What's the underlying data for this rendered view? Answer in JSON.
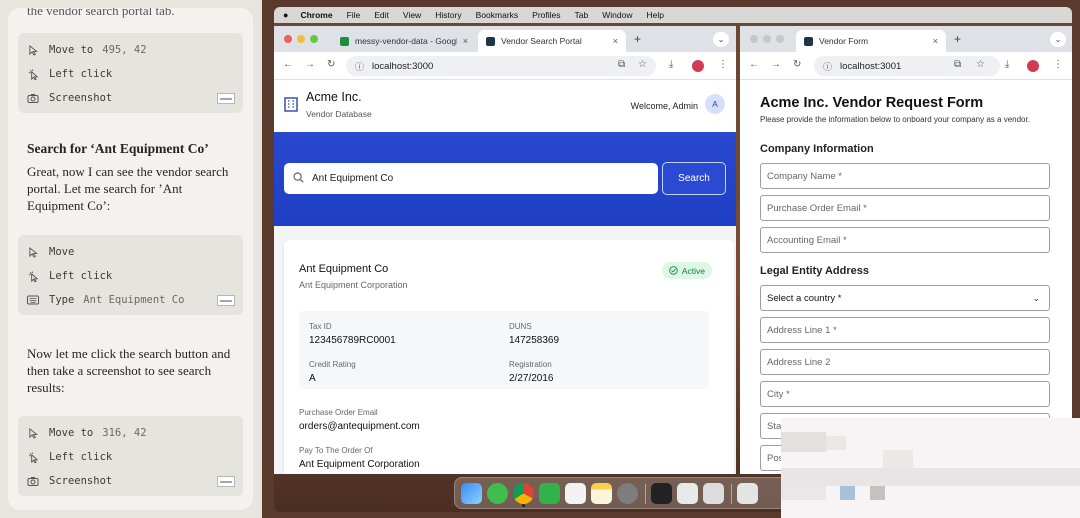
{
  "transcript": {
    "top_partial_text": "the vendor search portal tab.",
    "group1": [
      {
        "icon": "cursor-move-icon",
        "label": "Move to",
        "value": "495, 42"
      },
      {
        "icon": "click-icon",
        "label": "Left click",
        "value": ""
      },
      {
        "icon": "camera-icon",
        "label": "Screenshot",
        "value": ""
      }
    ],
    "msg1_title": "Search for ‘Ant Equipment Co’",
    "msg1_body": "Great, now I can see the vendor search portal. Let me search for ’Ant Equipment Co’:",
    "group2": [
      {
        "icon": "cursor-move-icon",
        "label": "Move",
        "value": ""
      },
      {
        "icon": "click-icon",
        "label": "Left click",
        "value": ""
      },
      {
        "icon": "keyboard-icon",
        "label": "Type",
        "value": "Ant Equipment Co"
      }
    ],
    "msg2_body": "Now let me click the search button and then take a screenshot to see search results:",
    "group3": [
      {
        "icon": "cursor-move-icon",
        "label": "Move to",
        "value": "316, 42"
      },
      {
        "icon": "click-icon",
        "label": "Left click",
        "value": ""
      },
      {
        "icon": "camera-icon",
        "label": "Screenshot",
        "value": ""
      }
    ]
  },
  "menubar": {
    "apple": "",
    "items": [
      "Chrome",
      "File",
      "Edit",
      "View",
      "History",
      "Bookmarks",
      "Profiles",
      "Tab",
      "Window",
      "Help"
    ]
  },
  "browser_left": {
    "tabs": [
      {
        "label": "messy-vendor-data - Google",
        "close": "×",
        "icon_color": "#1e8e3e"
      },
      {
        "label": "Vendor Search Portal",
        "close": "×",
        "icon_color": "#20344a"
      }
    ],
    "new_tab": "+",
    "tab_menu": "⌄",
    "url": "localhost:3000"
  },
  "portal": {
    "company": "Acme Inc.",
    "subtitle": "Vendor Database",
    "welcome": "Welcome, Admin",
    "avatar": "A",
    "search_value": "Ant Equipment Co",
    "search_button": "Search",
    "result": {
      "name": "Ant Equipment Co",
      "legal_name": "Ant Equipment Corporation",
      "status": "Active",
      "tax_id_label": "Tax ID",
      "tax_id": "123456789RC0001",
      "duns_label": "DUNS",
      "duns": "147258369",
      "credit_label": "Credit Rating",
      "credit": "A",
      "registration_label": "Registration",
      "registration": "2/27/2016",
      "po_email_label": "Purchase Order Email",
      "po_email": "orders@antequipment.com",
      "pay_to_label": "Pay To The Order Of",
      "pay_to": "Ant Equipment Corporation"
    }
  },
  "browser_right": {
    "tabs": [
      {
        "label": "Vendor Form",
        "close": "×",
        "icon_color": "#20344a"
      }
    ],
    "new_tab": "+",
    "tab_menu": "⌄",
    "url": "localhost:3001"
  },
  "form": {
    "title": "Acme Inc. Vendor Request Form",
    "description": "Please provide the information below to onboard your company as a vendor.",
    "section1": "Company Information",
    "company_name": "Company Name *",
    "po_email": "Purchase Order Email *",
    "accounting_email": "Accounting Email *",
    "section2": "Legal Entity Address",
    "country": "Select a country *",
    "address1": "Address Line 1 *",
    "address2": "Address Line 2",
    "city": "City *",
    "state_partial": "Sta",
    "postal_partial": "Pos"
  },
  "colors": {
    "portal_blue": "#2848cf",
    "active_badge_bg": "#dcf7e5",
    "active_badge_text": "#1a7b3f"
  }
}
